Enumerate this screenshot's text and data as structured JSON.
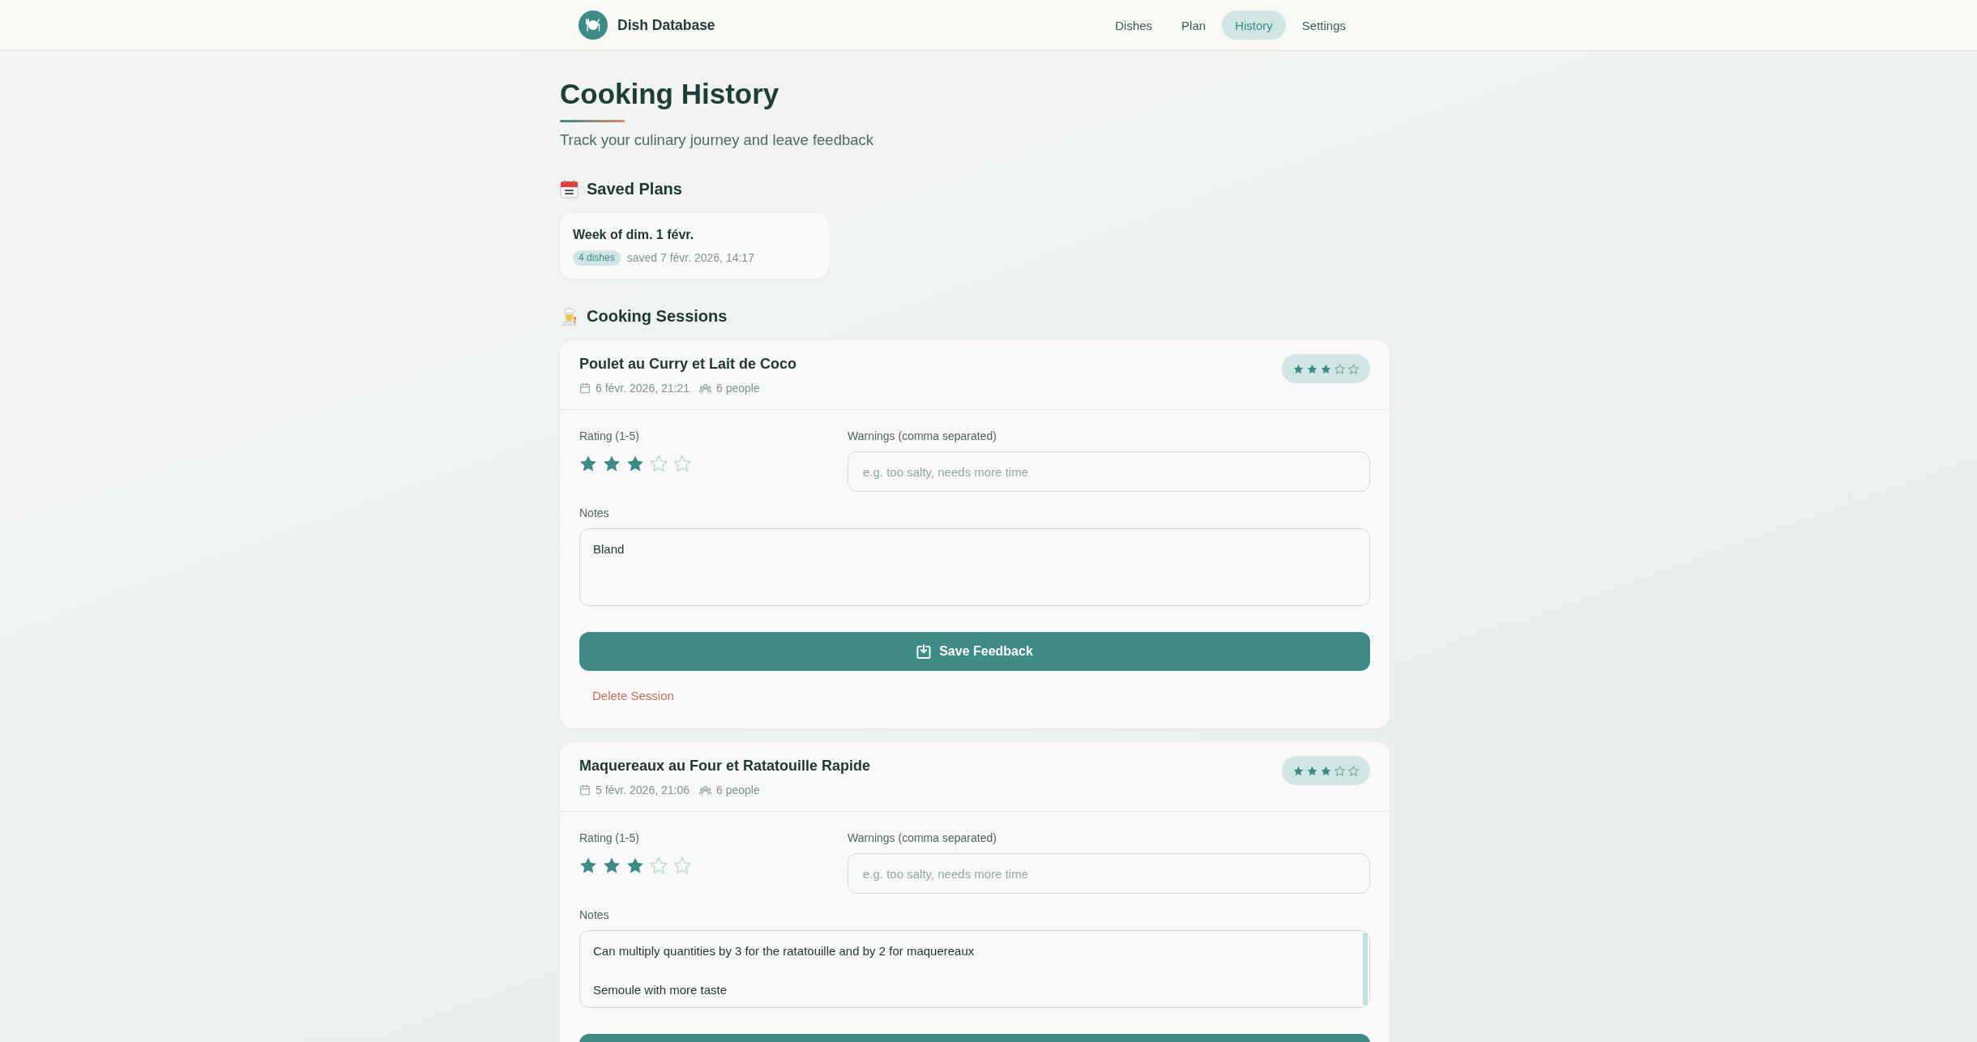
{
  "header": {
    "brand": "Dish Database",
    "nav": [
      {
        "label": "Dishes",
        "selected": false
      },
      {
        "label": "Plan",
        "selected": false
      },
      {
        "label": "History",
        "selected": true
      },
      {
        "label": "Settings",
        "selected": false
      }
    ]
  },
  "page": {
    "title": "Cooking History",
    "subtitle": "Track your culinary journey and leave feedback"
  },
  "saved_plans": {
    "heading": "Saved Plans",
    "plans": [
      {
        "title": "Week of dim. 1 févr.",
        "badge": "4 dishes",
        "saved": "saved 7 févr. 2026, 14:17"
      }
    ]
  },
  "sessions": {
    "heading": "Cooking Sessions",
    "items": [
      {
        "title": "Poulet au Curry et Lait de Coco",
        "date": "6 févr. 2026, 21:21",
        "people": "6 people",
        "badge": {
          "stars": 3
        },
        "rating": {
          "label": "Rating (1-5)",
          "stars": 3
        },
        "warnings": {
          "label": "Warnings (comma separated)",
          "placeholder": "e.g. too salty, needs more time"
        },
        "notes": {
          "label": "Notes",
          "value": "Bland"
        },
        "actions": [
          {
            "kind": "save",
            "label": "Save Feedback"
          },
          {
            "kind": "delete",
            "label": "Delete Session"
          }
        ]
      },
      {
        "title": "Maquereaux au Four et Ratatouille Rapide",
        "date": "5 févr. 2026, 21:06",
        "people": "6 people",
        "badge": {
          "stars": 3
        },
        "rating": {
          "label": "Rating (1-5)",
          "stars": 3
        },
        "warnings": {
          "label": "Warnings (comma separated)",
          "placeholder": "e.g. too salty, needs more time"
        },
        "notes": {
          "label": "Notes",
          "value": "Can multiply quantities by 3 for the ratatouille and by 2 for maquereaux\n\nSemoule with more taste"
        },
        "actions": [
          {
            "kind": "save"
          }
        ]
      }
    ]
  }
}
